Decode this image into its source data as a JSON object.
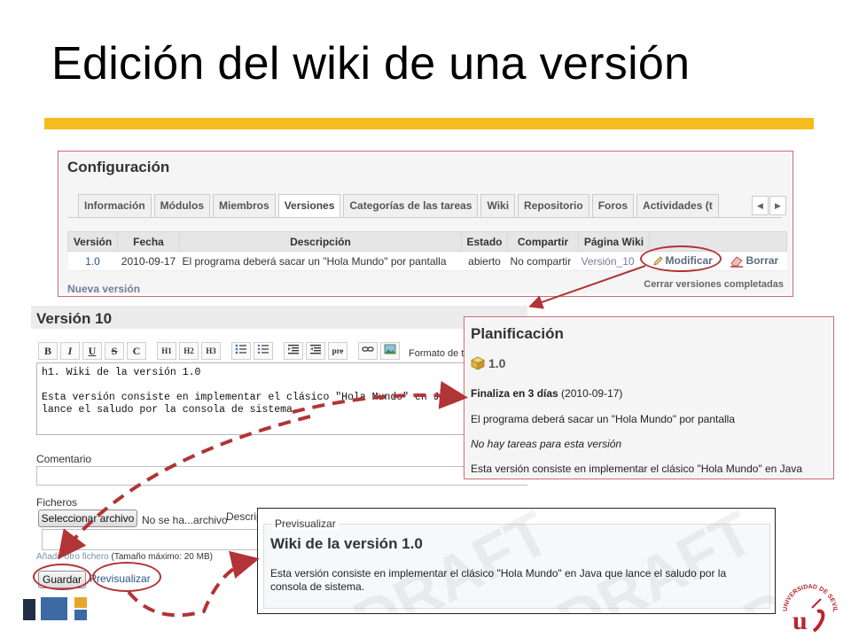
{
  "slide": {
    "title": "Edición del wiki de una versión"
  },
  "colors": {
    "accent_bar": "#f5bd1f",
    "panel_border": "#c9696f",
    "annotation_red": "#b13437",
    "link": "#2a5685"
  },
  "config": {
    "title": "Configuración",
    "tabs": [
      {
        "label": "Información",
        "active": false
      },
      {
        "label": "Módulos",
        "active": false
      },
      {
        "label": "Miembros",
        "active": false
      },
      {
        "label": "Versiones",
        "active": true
      },
      {
        "label": "Categorías de las tareas",
        "active": false
      },
      {
        "label": "Wiki",
        "active": false
      },
      {
        "label": "Repositorio",
        "active": false
      },
      {
        "label": "Foros",
        "active": false
      },
      {
        "label": "Actividades (t",
        "active": false
      }
    ],
    "tab_nav": {
      "prev": "◀",
      "next": "▶"
    },
    "table": {
      "headers": [
        "Versión",
        "Fecha",
        "Descripción",
        "Estado",
        "Compartir",
        "Página Wiki"
      ],
      "row": {
        "version": "1.0",
        "fecha": "2010-09-17",
        "descripcion": "El programa deberá sacar un \"Hola Mundo\" por pantalla",
        "estado": "abierto",
        "compartir": "No compartir",
        "pagina_wiki": "Versión_10",
        "modificar": "Modificar",
        "borrar": "Borrar"
      }
    },
    "new_version": "Nueva versión",
    "close_completed": "Cerrar versiones completadas"
  },
  "editor": {
    "title": "Versión 10",
    "toolbar": [
      "B",
      "I",
      "U",
      "S",
      "C",
      "H1",
      "H2",
      "H3",
      "ul-list",
      "ol-list",
      "quote",
      "unquote",
      "pre",
      "link",
      "image"
    ],
    "format_label": "Formato de te",
    "wiki_text": "h1. Wiki de la versión 1.0\n\nEsta versión consiste en implementar el clásico \"Hola Mundo\" en Java que\nlance el saludo por la consola de sistema.",
    "comment_label": "Comentario",
    "files_label": "Ficheros",
    "select_file_button": "Seleccionar archivo",
    "no_file_text": "No se ha...archivo",
    "description_label": "Descrip",
    "add_file_link": "Añadir otro fichero",
    "max_size": "(Tamaño máximo: 20 MB)",
    "save_button": "Guardar",
    "preview_link": "Previsualizar"
  },
  "planning": {
    "title": "Planificación",
    "version": "1.0",
    "due_bold": "Finaliza en 3 días",
    "due_date": "(2010-09-17)",
    "description": "El programa deberá sacar un \"Hola Mundo\" por pantalla",
    "no_issues": "No hay tareas para esta versión",
    "wiki_excerpt": "Esta versión consiste en implementar el clásico \"Hola Mundo\" en Java"
  },
  "preview": {
    "legend": "Previsualizar",
    "heading": "Wiki de la versión 1.0",
    "paragraph": "Esta versión consiste en implementar el clásico \"Hola Mundo\" en Java que lance el saludo por la consola de sistema.",
    "watermark": "DRAFT"
  },
  "seal": {
    "text": "UNIVERSIDAD DE SEVILLA"
  }
}
